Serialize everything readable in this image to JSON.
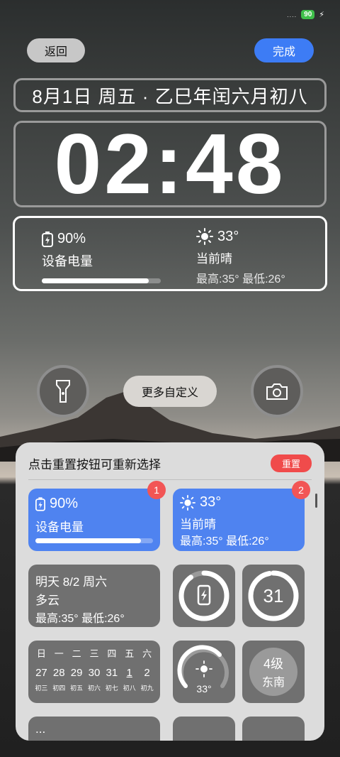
{
  "status": {
    "signal": "....",
    "battery": "90"
  },
  "top": {
    "back_label": "返回",
    "done_label": "完成"
  },
  "lock": {
    "date_line": "8月1日 周五 · 乙巳年闰六月初八",
    "time": "02:48",
    "battery": {
      "percent": "90%",
      "label": "设备电量",
      "level": 0.9
    },
    "weather": {
      "temp": "33°",
      "cond": "当前晴",
      "range": "最高:35° 最低:26°"
    }
  },
  "more_label": "更多自定义",
  "panel": {
    "hint": "点击重置按钮可重新选择",
    "reset_label": "重置",
    "tile1": {
      "badge": "1",
      "percent": "90%",
      "label": "设备电量",
      "level": 0.9
    },
    "tile2": {
      "badge": "2",
      "temp": "33°",
      "cond": "当前晴",
      "range": "最高:35° 最低:26°"
    },
    "tile3": {
      "line1": "明天 8/2 周六",
      "line2": "多云",
      "line3": "最高:35° 最低:26°"
    },
    "tile5": {
      "day": "31"
    },
    "calendar": {
      "weekdays": [
        "日",
        "一",
        "二",
        "三",
        "四",
        "五",
        "六"
      ],
      "days": [
        "27",
        "28",
        "29",
        "30",
        "31",
        "1",
        "2"
      ],
      "lunar": [
        "初三",
        "初四",
        "初五",
        "初六",
        "初七",
        "初八",
        "初九"
      ]
    },
    "tile7": {
      "temp": "33°"
    },
    "tile8": {
      "level": "4级",
      "dir": "东南"
    },
    "tile9": {
      "text": "..."
    }
  }
}
